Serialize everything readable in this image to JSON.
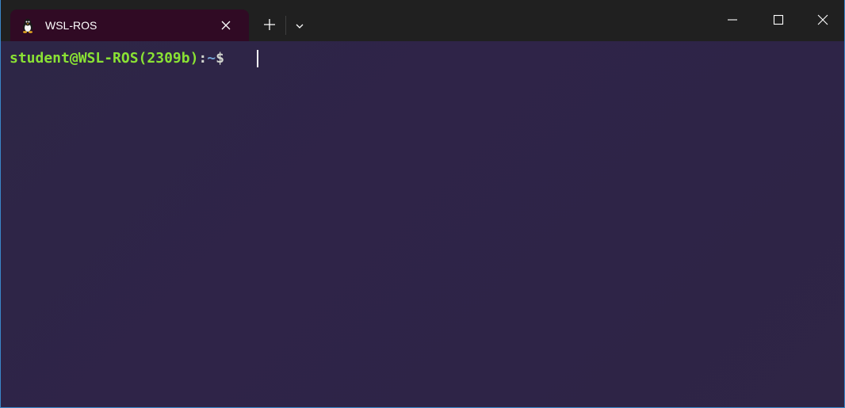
{
  "tab": {
    "title": "WSL-ROS",
    "icon": "linux-tux-icon",
    "background_color": "#300a24"
  },
  "tabbar": {
    "new_tab_icon": "plus-icon",
    "dropdown_icon": "chevron-down-icon"
  },
  "window_controls": {
    "minimize_icon": "minimize-icon",
    "maximize_icon": "maximize-icon",
    "close_icon": "close-icon"
  },
  "terminal": {
    "prompt": {
      "user_host": "student@WSL-ROS(2309b)",
      "colon": ":",
      "path": "~",
      "symbol": "$ "
    },
    "colors": {
      "user_host": "#8ae234",
      "path": "#729fcf",
      "background": "#2e2547"
    }
  }
}
